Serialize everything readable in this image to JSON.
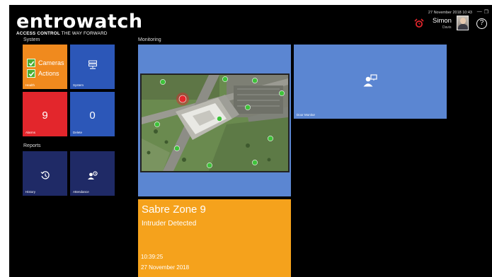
{
  "brand": {
    "logo_text": "entrowatch",
    "tagline_bold": "ACCESS CONTROL",
    "tagline_rest": " THE WAY FORWARD"
  },
  "topbar": {
    "datetime": "27 November 2018 10:43",
    "user_name": "Simon",
    "user_sub": "Davis",
    "help_symbol": "?",
    "window_minimize": "—",
    "window_restore": "❐"
  },
  "sections": {
    "system": "System",
    "reports": "Reports",
    "monitoring": "Monitoring"
  },
  "tiles": {
    "health": {
      "caption": "Health",
      "checks": [
        "Cameras",
        "Actions"
      ],
      "color": "#f08a1e"
    },
    "system": {
      "caption": "System",
      "icon": "server-icon",
      "color": "#2c57b8"
    },
    "alarms": {
      "caption": "Alarms",
      "count": "9",
      "color": "#e3262c"
    },
    "delete": {
      "caption": "Delete",
      "count": "0",
      "color": "#2c57b8"
    },
    "history": {
      "caption": "History",
      "icon": "history-icon",
      "color": "#1f2a66"
    },
    "attendance": {
      "caption": "Attendance",
      "icon": "attendance-icon",
      "color": "#1f2a66"
    }
  },
  "monitoring": {
    "map_tile_color": "#5b86d2",
    "door_monitor": {
      "caption": "Door Monitor",
      "icon": "door-monitor-icon",
      "color": "#5b86d2"
    },
    "event": {
      "zone": "Sabre Zone 9",
      "status": "Intruder Detected",
      "time": "10:39:25",
      "date": "27 November 2018",
      "color": "#f5a21c"
    }
  },
  "colors": {
    "background": "#000000",
    "map_marker_alarm": "#e3262c",
    "map_marker_ok": "#3fc23a"
  }
}
